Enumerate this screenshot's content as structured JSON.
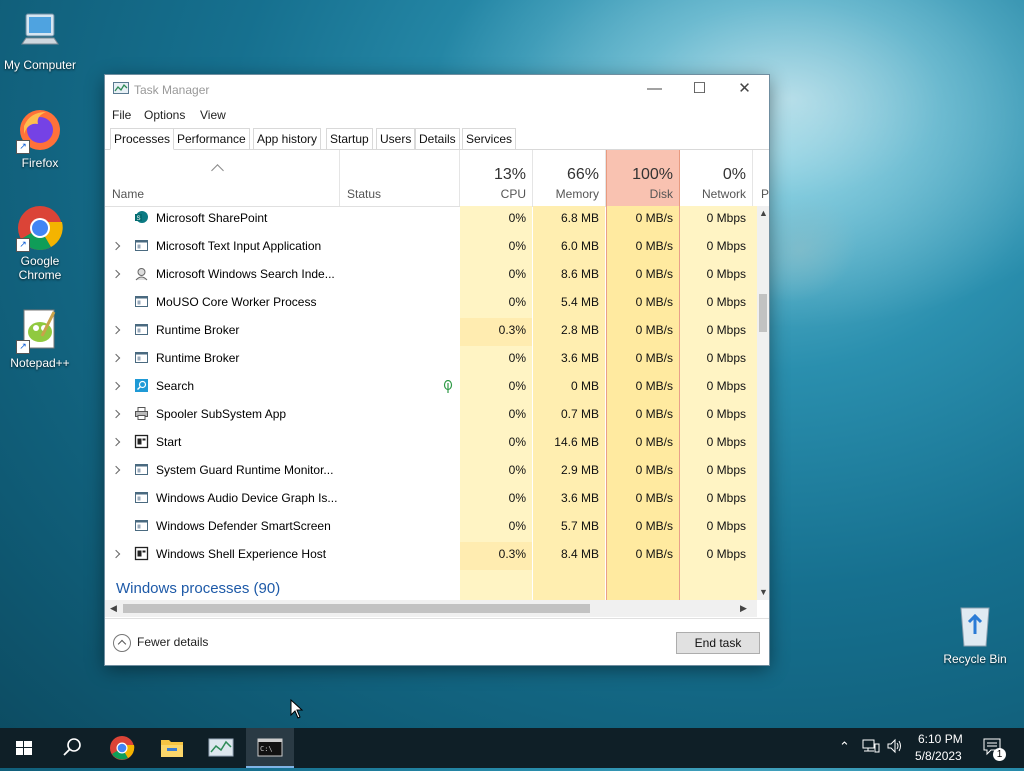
{
  "desktop": {
    "icons": [
      {
        "label": "My Computer",
        "icon": "computer-icon"
      },
      {
        "label": "Firefox",
        "icon": "firefox-icon"
      },
      {
        "label": "Google Chrome",
        "icon": "chrome-icon"
      },
      {
        "label": "Notepad++",
        "icon": "notepadpp-icon"
      },
      {
        "label": "Recycle Bin",
        "icon": "recycle-bin-icon"
      }
    ]
  },
  "window": {
    "title": "Task Manager",
    "menu": [
      "File",
      "Options",
      "View"
    ],
    "tabs": [
      "Processes",
      "Performance",
      "App history",
      "Startup",
      "Users",
      "Details",
      "Services"
    ],
    "active_tab": "Processes",
    "columns": {
      "name": "Name",
      "status": "Status",
      "cpu": {
        "pct": "13%",
        "label": "CPU"
      },
      "memory": {
        "pct": "66%",
        "label": "Memory"
      },
      "disk": {
        "pct": "100%",
        "label": "Disk"
      },
      "network": {
        "pct": "0%",
        "label": "Network"
      },
      "power": "P"
    },
    "processes": [
      {
        "name": "Microsoft SharePoint",
        "expandable": false,
        "icon": "sharepoint-icon",
        "status": "",
        "cpu": "0%",
        "memory": "6.8 MB",
        "disk": "0 MB/s",
        "network": "0 Mbps"
      },
      {
        "name": "Microsoft Text Input Application",
        "expandable": true,
        "icon": "app-window-icon",
        "status": "",
        "cpu": "0%",
        "memory": "6.0 MB",
        "disk": "0 MB/s",
        "network": "0 Mbps"
      },
      {
        "name": "Microsoft Windows Search Inde...",
        "expandable": true,
        "icon": "search-indexer-icon",
        "status": "",
        "cpu": "0%",
        "memory": "8.6 MB",
        "disk": "0 MB/s",
        "network": "0 Mbps"
      },
      {
        "name": "MoUSO Core Worker Process",
        "expandable": false,
        "icon": "app-window-icon",
        "status": "",
        "cpu": "0%",
        "memory": "5.4 MB",
        "disk": "0 MB/s",
        "network": "0 Mbps"
      },
      {
        "name": "Runtime Broker",
        "expandable": true,
        "icon": "app-window-icon",
        "status": "",
        "cpu": "0.3%",
        "memory": "2.8 MB",
        "disk": "0 MB/s",
        "network": "0 Mbps"
      },
      {
        "name": "Runtime Broker",
        "expandable": true,
        "icon": "app-window-icon",
        "status": "",
        "cpu": "0%",
        "memory": "3.6 MB",
        "disk": "0 MB/s",
        "network": "0 Mbps"
      },
      {
        "name": "Search",
        "expandable": true,
        "icon": "search-app-icon",
        "status": "suspended-leaf",
        "cpu": "0%",
        "memory": "0 MB",
        "disk": "0 MB/s",
        "network": "0 Mbps"
      },
      {
        "name": "Spooler SubSystem App",
        "expandable": true,
        "icon": "printer-icon",
        "status": "",
        "cpu": "0%",
        "memory": "0.7 MB",
        "disk": "0 MB/s",
        "network": "0 Mbps"
      },
      {
        "name": "Start",
        "expandable": true,
        "icon": "start-app-icon",
        "status": "",
        "cpu": "0%",
        "memory": "14.6 MB",
        "disk": "0 MB/s",
        "network": "0 Mbps"
      },
      {
        "name": "System Guard Runtime Monitor...",
        "expandable": true,
        "icon": "app-window-icon",
        "status": "",
        "cpu": "0%",
        "memory": "2.9 MB",
        "disk": "0 MB/s",
        "network": "0 Mbps"
      },
      {
        "name": "Windows Audio Device Graph Is...",
        "expandable": false,
        "icon": "app-window-icon",
        "status": "",
        "cpu": "0%",
        "memory": "3.6 MB",
        "disk": "0 MB/s",
        "network": "0 Mbps"
      },
      {
        "name": "Windows Defender SmartScreen",
        "expandable": false,
        "icon": "app-window-icon",
        "status": "",
        "cpu": "0%",
        "memory": "5.7 MB",
        "disk": "0 MB/s",
        "network": "0 Mbps"
      },
      {
        "name": "Windows Shell Experience Host",
        "expandable": true,
        "icon": "start-app-icon",
        "status": "",
        "cpu": "0.3%",
        "memory": "8.4 MB",
        "disk": "0 MB/s",
        "network": "0 Mbps"
      }
    ],
    "group_label": "Windows processes (90)",
    "footer": {
      "fewer_details": "Fewer details",
      "end_task": "End task"
    }
  },
  "colors": {
    "cpu_bg": "#fff4c4",
    "cpu_bg_hot": "#ffecb0",
    "memory_bg": "#ffeeb0",
    "disk_bg": "#ffeaa0",
    "disk_header": "#f9c2b1",
    "network_bg": "#fff4c4",
    "group_text": "#1e5aa8"
  },
  "taskbar": {
    "items": [
      "start-icon",
      "search-icon",
      "chrome-icon",
      "file-explorer-icon",
      "task-manager-icon",
      "terminal-icon"
    ],
    "active_item": "terminal-icon",
    "clock_time": "6:10 PM",
    "clock_date": "5/8/2023",
    "notification_count": "1"
  }
}
